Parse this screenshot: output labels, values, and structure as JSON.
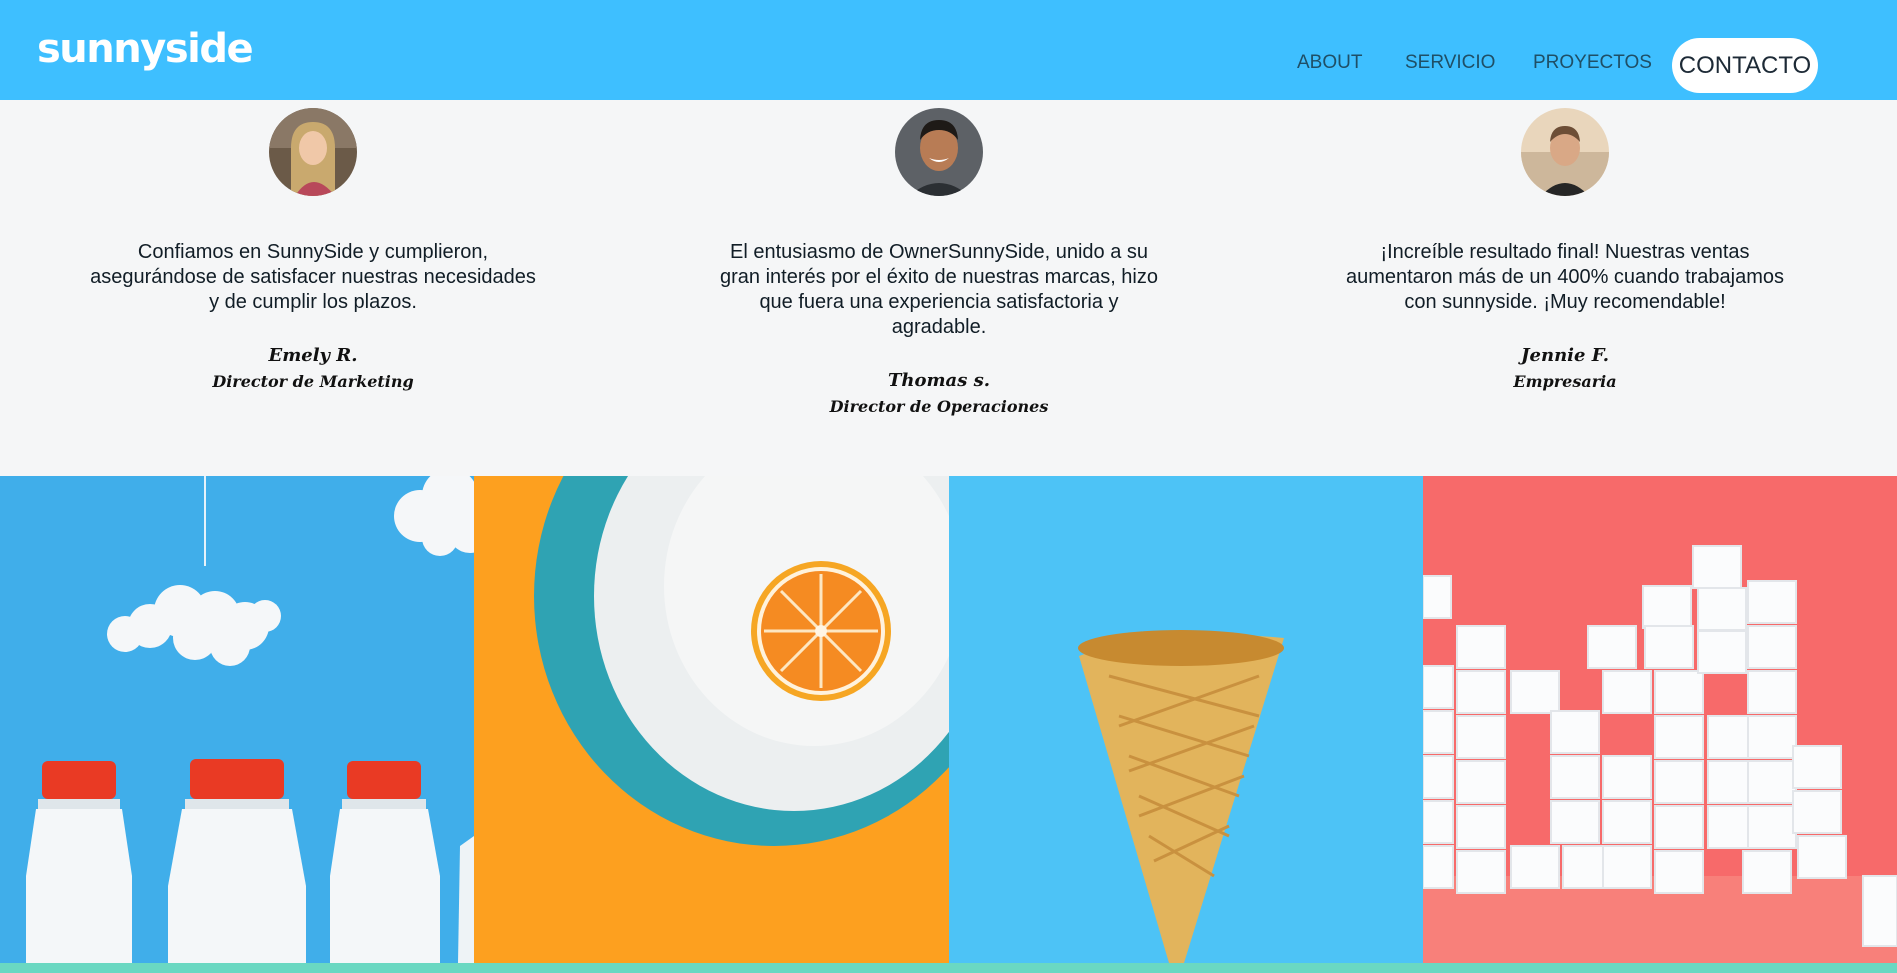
{
  "header": {
    "logo": "sunnyside",
    "nav": {
      "about": "ABOUT",
      "servicio": "SERVICIO",
      "proyectos": "PROYECTOS",
      "contacto": "CONTACTO"
    }
  },
  "testimonials": [
    {
      "avatar_icon": "avatar-woman-long-hair",
      "quote": "Confiamos en SunnySide y cumplieron, asegurándose de satisfacer nuestras necesidades y de cumplir los plazos.",
      "name": "Emely R.",
      "role": "Director de Marketing"
    },
    {
      "avatar_icon": "avatar-man-smiling",
      "quote": "El entusiasmo de OwnerSunnySide, unido a su gran interés por el éxito de nuestras marcas, hizo que fuera una experiencia satisfactoria y agradable.",
      "name": "Thomas s.",
      "role": "Director de Operaciones"
    },
    {
      "avatar_icon": "avatar-woman-short-hair",
      "quote": "¡Increíble resultado final! Nuestras ventas aumentaron más de un 400% cuando trabajamos con sunnyside. ¡Muy recomendable!",
      "name": "Jennie F.",
      "role": "Empresaria"
    }
  ],
  "gallery": {
    "images": [
      "milk-bottles-image",
      "orange-plate-image",
      "ice-cream-cone-image",
      "sugar-cubes-image"
    ]
  },
  "colors": {
    "header_bg": "#3ebfff",
    "page_bg": "#f5f6f7",
    "nav_text": "#1f4f66",
    "bottom_bar": "#6ad8c2"
  }
}
